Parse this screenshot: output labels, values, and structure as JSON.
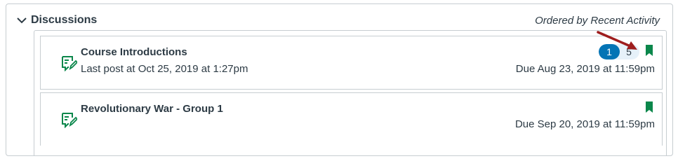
{
  "section": {
    "title": "Discussions",
    "order_label": "Ordered by Recent Activity"
  },
  "discussions": [
    {
      "title": "Course Introductions",
      "last_post": "Last post at Oct 25, 2019 at 1:27pm",
      "due": "Due Aug 23, 2019 at 11:59pm",
      "unread_count": "1",
      "total_count": "5",
      "bookmark_color": "#0b874b",
      "icon": "discussion-icon"
    },
    {
      "title": "Revolutionary War - Group 1",
      "last_post": "",
      "due": "Due Sep 20, 2019 at 11:59pm",
      "bookmark_color": "#0b874b",
      "icon": "discussion-icon"
    }
  ],
  "colors": {
    "accent": "#0374b5",
    "icon_green": "#0b874b",
    "annotation_arrow": "#9e1d1d"
  }
}
